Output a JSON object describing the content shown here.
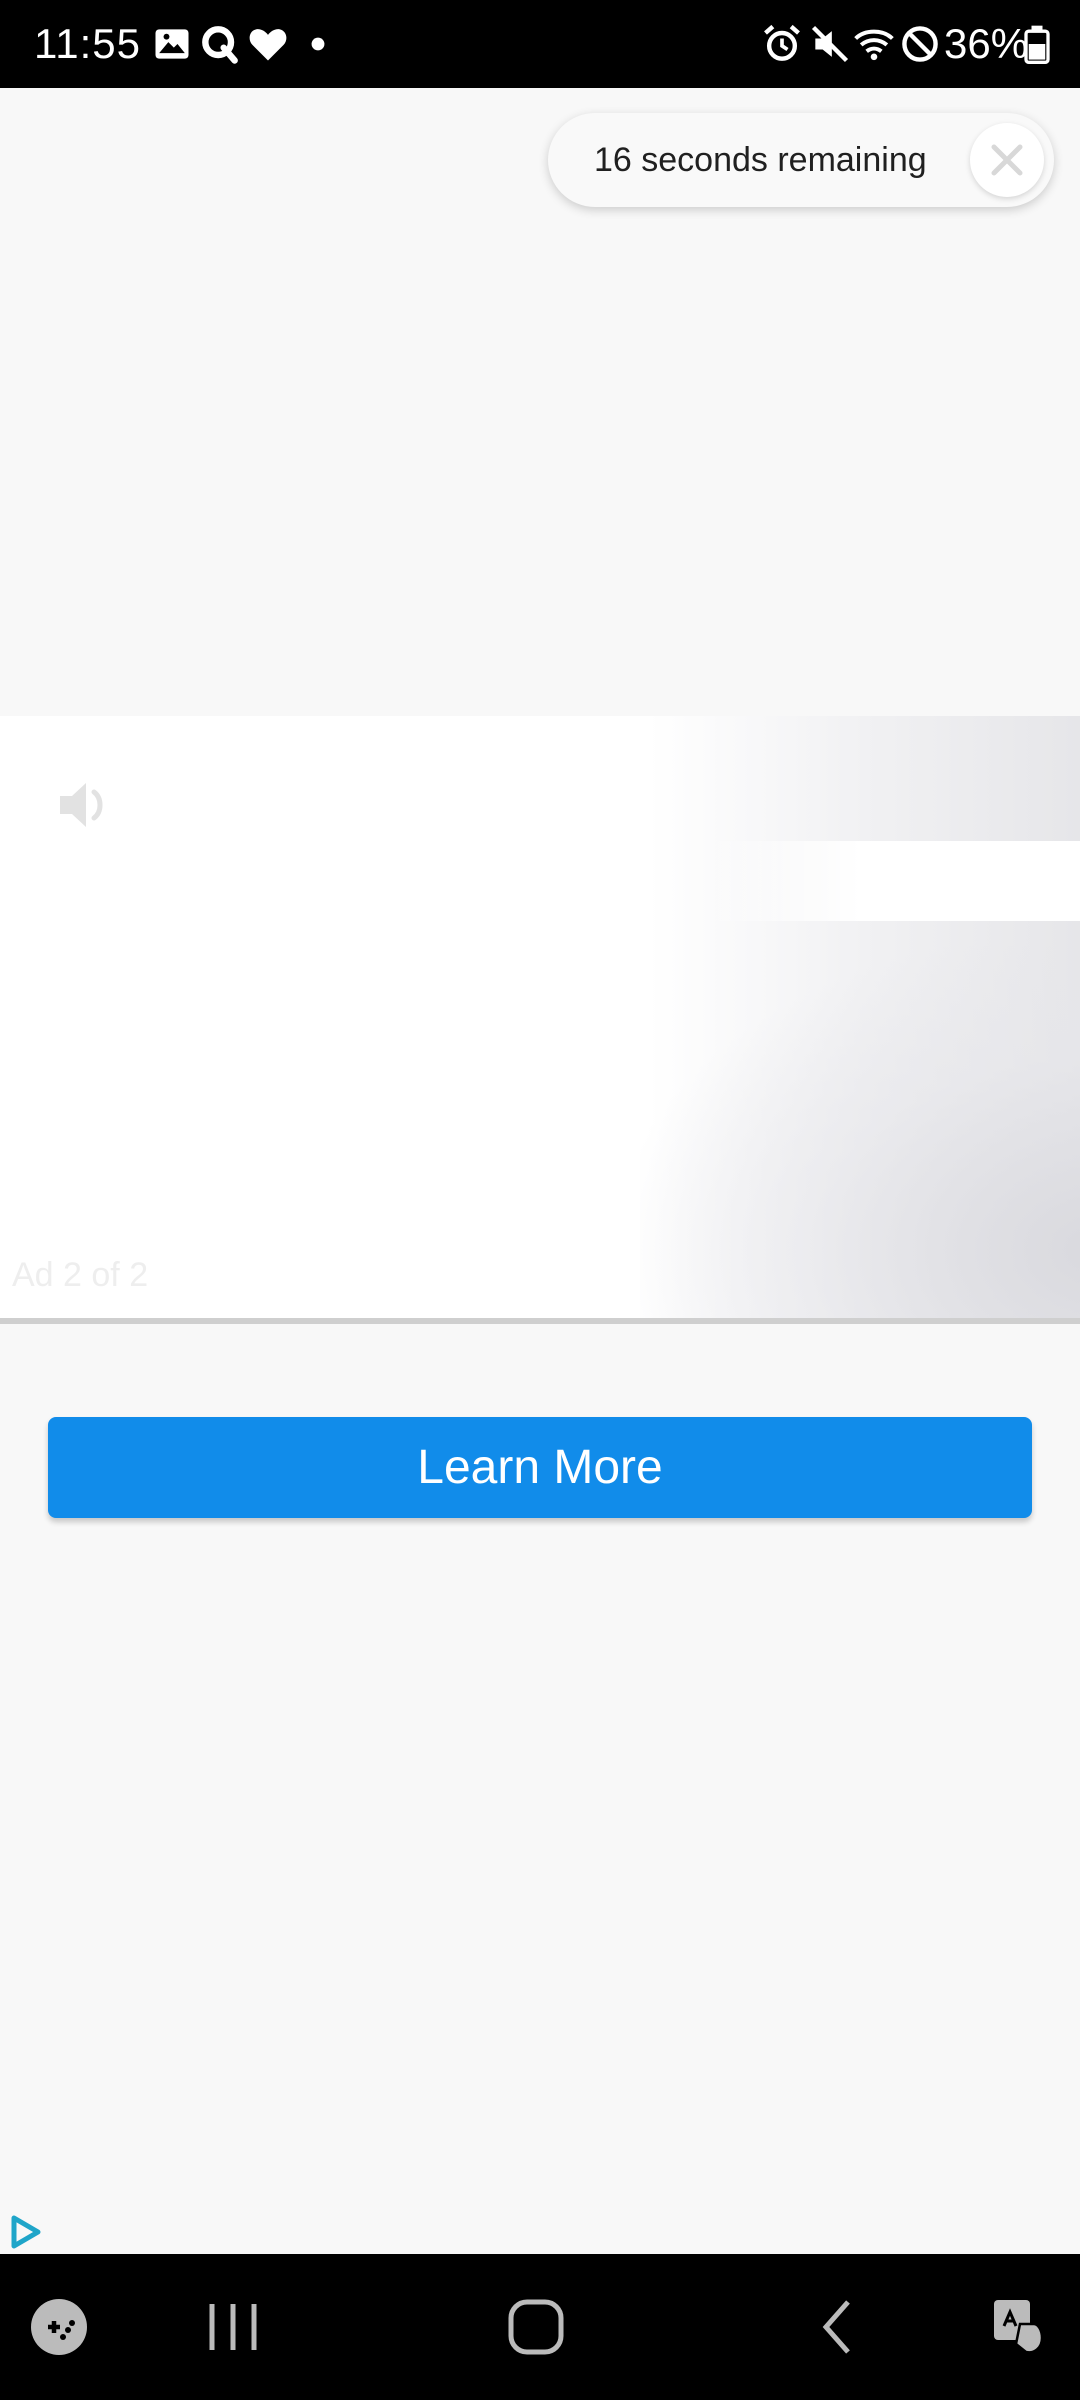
{
  "status_bar": {
    "time": "11:55",
    "battery_percent": "36%",
    "left_icons": [
      "image-icon",
      "q-app-icon",
      "heart-icon",
      "dot-icon"
    ],
    "right_icons": [
      "alarm-icon",
      "mute-icon",
      "wifi-icon",
      "do-not-disturb-icon",
      "battery-icon"
    ]
  },
  "ad": {
    "countdown_text": "16 seconds remaining",
    "ad_counter": "Ad 2 of 2",
    "learn_more_label": "Learn More",
    "accent_color": "#118cea"
  },
  "nav_bar": {
    "icons": [
      "game-launcher-icon",
      "recent-apps-icon",
      "home-icon",
      "back-icon",
      "accessibility-icon"
    ]
  }
}
